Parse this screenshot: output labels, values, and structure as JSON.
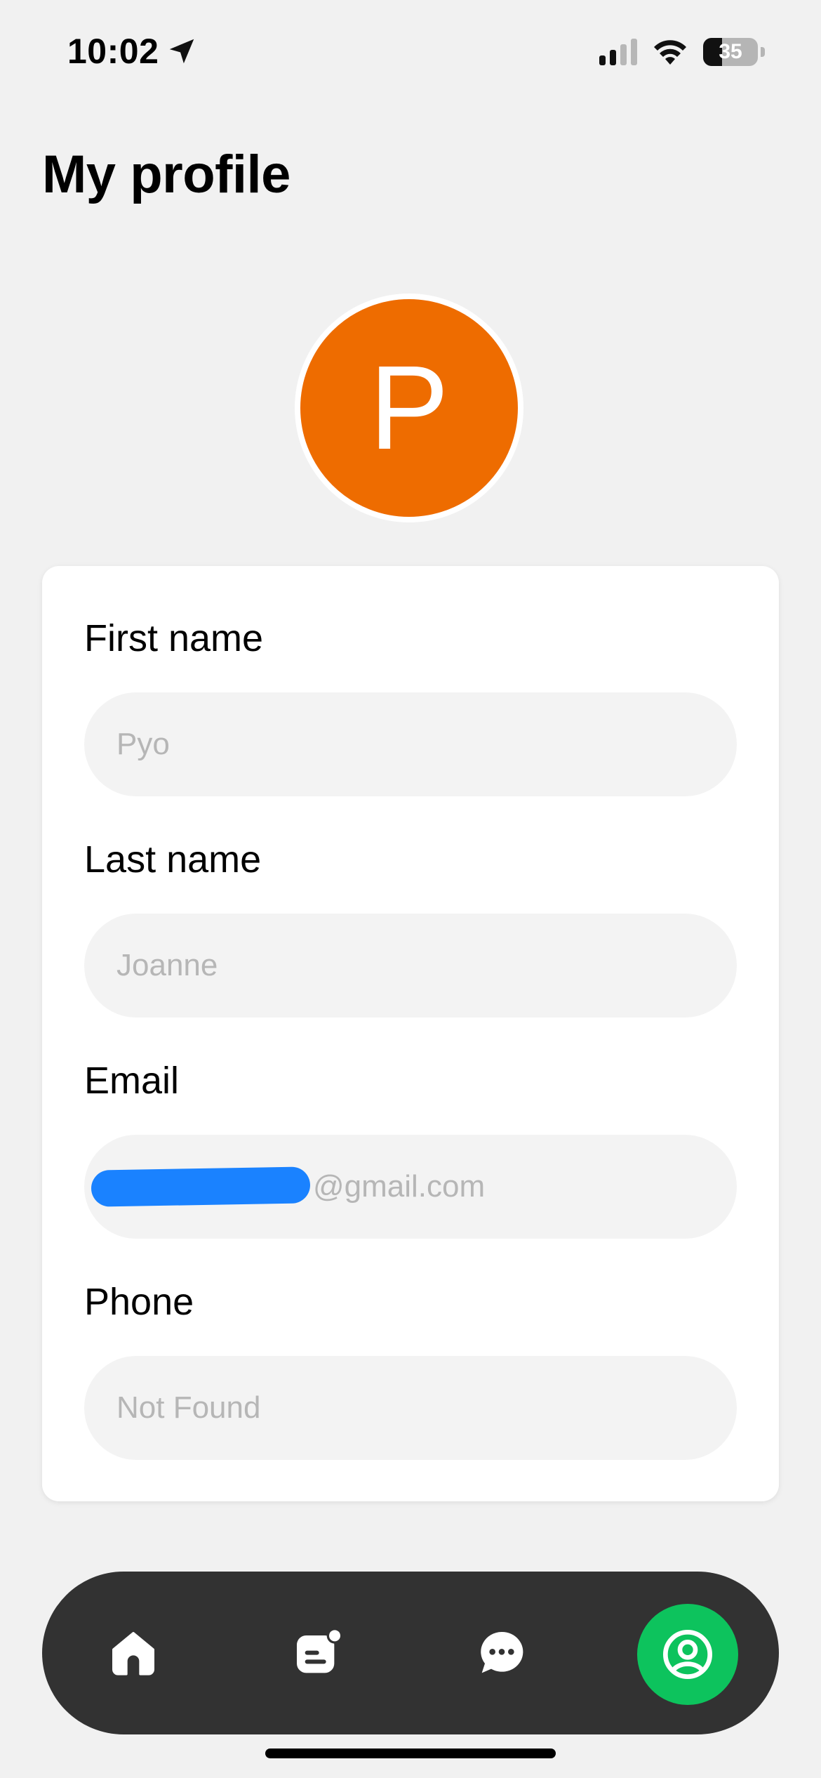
{
  "status_bar": {
    "time": "10:02",
    "battery_percent": "35",
    "battery_level": 0.35,
    "icons": [
      "location-arrow-icon",
      "signal-icon",
      "wifi-icon",
      "battery-icon"
    ]
  },
  "page": {
    "title": "My profile"
  },
  "avatar": {
    "initial": "P",
    "color": "#ee6c00"
  },
  "form": {
    "first_name": {
      "label": "First name",
      "value": "Pyo"
    },
    "last_name": {
      "label": "Last name",
      "value": "Joanne"
    },
    "email": {
      "label": "Email",
      "value": "@gmail.com"
    },
    "phone": {
      "label": "Phone",
      "value": "Not Found"
    }
  },
  "bottom_nav": {
    "items": [
      {
        "icon": "home-icon",
        "active": false
      },
      {
        "icon": "news-icon",
        "active": false
      },
      {
        "icon": "chat-icon",
        "active": false
      },
      {
        "icon": "profile-icon",
        "active": true
      }
    ],
    "active_color": "#0dc35d",
    "background_color": "#323232"
  }
}
